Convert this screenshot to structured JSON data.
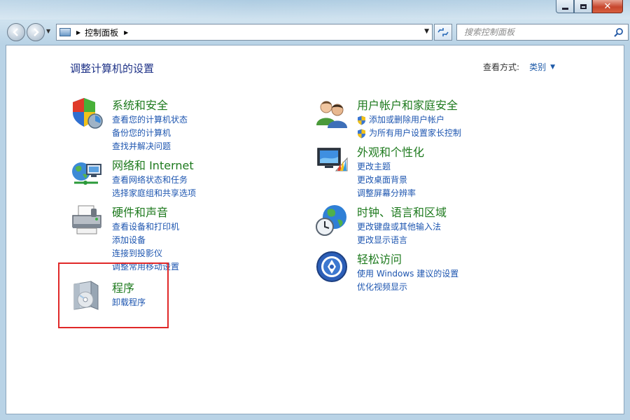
{
  "window": {
    "controls": {
      "minimize_icon": "minimize-icon",
      "maximize_icon": "maximize-icon",
      "close_icon": "close-icon",
      "close_glyph": "✕"
    }
  },
  "nav": {
    "address_text": "控制面板",
    "search_placeholder": "搜索控制面板"
  },
  "main": {
    "title": "调整计算机的设置",
    "view_by_label": "查看方式:",
    "view_by_value": "类别"
  },
  "categories": [
    {
      "heading": "系统和安全",
      "icon": "shield-icon",
      "links": [
        "查看您的计算机状态",
        "备份您的计算机",
        "查找并解决问题"
      ]
    },
    {
      "heading": "网络和 Internet",
      "icon": "network-globe-icon",
      "links": [
        "查看网络状态和任务",
        "选择家庭组和共享选项"
      ]
    },
    {
      "heading": "硬件和声音",
      "icon": "printer-icon",
      "links": [
        "查看设备和打印机",
        "添加设备",
        "连接到投影仪",
        "调整常用移动设置"
      ]
    },
    {
      "heading": "程序",
      "icon": "programs-icon",
      "links": [
        "卸载程序"
      ]
    },
    {
      "heading": "用户帐户和家庭安全",
      "icon": "users-icon",
      "links": [
        "添加或删除用户帐户",
        "为所有用户设置家长控制"
      ]
    },
    {
      "heading": "外观和个性化",
      "icon": "appearance-icon",
      "links": [
        "更改主题",
        "更改桌面背景",
        "调整屏幕分辨率"
      ]
    },
    {
      "heading": "时钟、语言和区域",
      "icon": "clock-globe-icon",
      "links": [
        "更改键盘或其他输入法",
        "更改显示语言"
      ]
    },
    {
      "heading": "轻松访问",
      "icon": "ease-of-access-icon",
      "links": [
        "使用 Windows 建议的设置",
        "优化视频显示"
      ]
    }
  ],
  "colors": {
    "heading_green": "#1e7a1e",
    "link_blue": "#1e56b0",
    "title_blue": "#1e3287",
    "highlight_red": "#e02828"
  }
}
